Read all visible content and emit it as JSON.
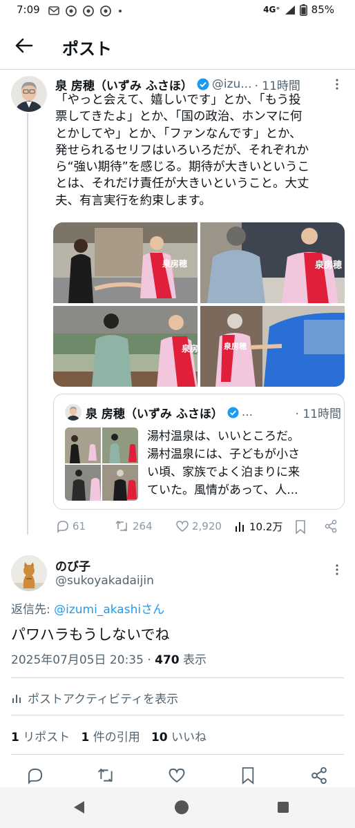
{
  "status_bar": {
    "time": "7:09",
    "network": "4G⁺",
    "battery": "85%"
  },
  "header": {
    "title": "ポスト"
  },
  "tweet": {
    "author_name": "泉 房穂（いずみ ふさほ）",
    "author_handle": "@izu...",
    "time": "· 11時間",
    "text": "「やっと会えて、嬉しいです」とか、「もう投\n票してきたよ」とか、「国の政治、ホンマに何\nとかしてや」とか、「ファンなんです」とか、\n発せられるセリフはいろいろだが、それぞれか\nら“強い期待”を感じる。期待が大きいというこ\nとは、それだけ責任が大きいということ。大丈\n夫、有言実行を約束します。",
    "sash_text": "泉房穂",
    "quote": {
      "author_name": "泉 房穂（いずみ ふさほ）",
      "dots": "...",
      "time": "· 11時間",
      "text": "湯村温泉は、いいところだ。\n湯村温泉には、子どもが小さ\nい頃、家族でよく泊まりに来\nていた。風情があって、人..."
    },
    "counts": {
      "replies": "61",
      "reposts": "264",
      "likes": "2,920",
      "views": "10.2万"
    }
  },
  "reply": {
    "author_name": "のび子",
    "author_handle": "@sukoyakadaijin",
    "reply_to_label": "返信先: ",
    "reply_to_user": "@izumi_akashiさん",
    "text": "パワハラもうしないでね",
    "date": "2025年07月05日 20:35 · ",
    "views_count": "470",
    "views_label": " 表示",
    "activity_label": "ポストアクティビティを表示",
    "stats": {
      "reposts_count": "1",
      "reposts_label": " リポスト",
      "quotes_count": "1",
      "quotes_label": " 件の引用",
      "likes_count": "10",
      "likes_label": " いいね"
    }
  },
  "colors": {
    "accent": "#1d9bf0",
    "muted": "#536471",
    "divider": "#cfd9de",
    "sash": "#e0203a"
  }
}
